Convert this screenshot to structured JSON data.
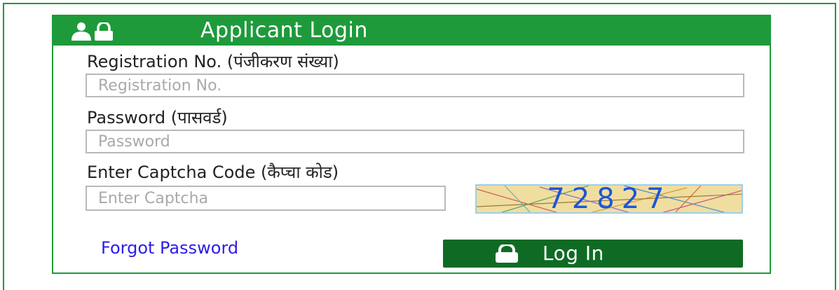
{
  "header": {
    "title": "Applicant Login",
    "icon": "user-lock-icon"
  },
  "registration": {
    "label": "Registration No. (पंजीकरण संख्या)",
    "placeholder": "Registration No.",
    "value": ""
  },
  "password": {
    "label": "Password (पासवर्ड)",
    "placeholder": "Password",
    "value": ""
  },
  "captcha": {
    "label": "Enter Captcha Code (कैप्चा कोड)",
    "placeholder": "Enter Captcha",
    "value": "",
    "code": "72827"
  },
  "links": {
    "forgot": "Forgot Password"
  },
  "login_button": {
    "label": "Log In",
    "icon": "lock-icon"
  },
  "colors": {
    "brand_green": "#1e9a3a",
    "button_green": "#0f6b24",
    "link_blue": "#2d1ce8",
    "captcha_text": "#1c55d9"
  }
}
